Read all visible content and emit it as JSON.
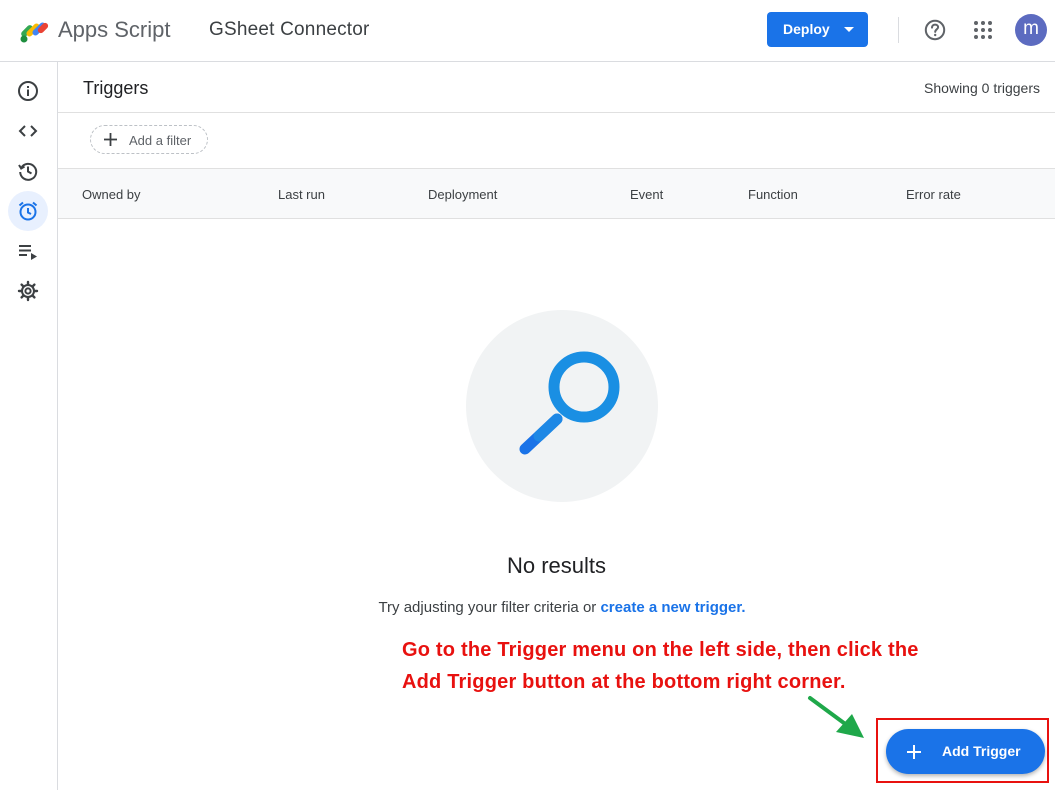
{
  "header": {
    "app_name": "Apps Script",
    "project_name": "GSheet Connector",
    "deploy_label": "Deploy",
    "avatar_initial": "m",
    "accent": "#1a73e8"
  },
  "sidebar": {
    "items": [
      {
        "name": "overview",
        "icon": "info-icon",
        "active": false
      },
      {
        "name": "editor",
        "icon": "code-icon",
        "active": false
      },
      {
        "name": "executions-history",
        "icon": "history-icon",
        "active": false
      },
      {
        "name": "triggers",
        "icon": "alarm-clock-icon",
        "active": true
      },
      {
        "name": "executions",
        "icon": "playlist-play-icon",
        "active": false
      },
      {
        "name": "project-settings",
        "icon": "gear-icon",
        "active": false
      }
    ]
  },
  "main": {
    "title": "Triggers",
    "showing": "Showing 0 triggers",
    "filter_label": "Add a filter",
    "columns": [
      "Owned by",
      "Last run",
      "Deployment",
      "Event",
      "Function",
      "Error rate"
    ],
    "empty_title": "No results",
    "empty_hint": "Try adjusting your filter criteria or",
    "empty_link": "create a new trigger.",
    "add_trigger_label": "Add Trigger"
  },
  "annotation": {
    "line1": "Go to the Trigger menu on the left side, then click the",
    "line2": "Add Trigger button at the bottom right corner.",
    "color": "#e8110f",
    "arrow_color": "#1fa84a"
  }
}
